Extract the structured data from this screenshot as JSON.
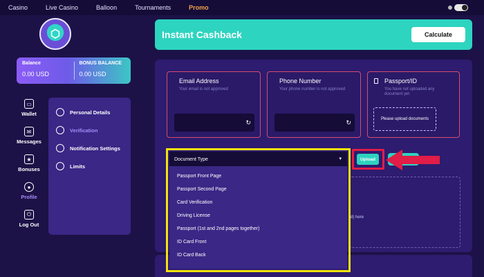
{
  "nav": {
    "items": [
      "Casino",
      "Live Casino",
      "Balloon",
      "Tournaments"
    ],
    "promo": "Promo"
  },
  "balance": {
    "label": "Balance",
    "value": "0.00 USD",
    "bonus_label": "BONUS BALANCE",
    "bonus_value": "0.00 USD"
  },
  "sidebar": {
    "items": [
      {
        "label": "Wallet",
        "icon": "wallet-icon"
      },
      {
        "label": "Messages",
        "icon": "messages-icon"
      },
      {
        "label": "Bonuses",
        "icon": "bonus-icon"
      },
      {
        "label": "Profile",
        "icon": "profile-icon",
        "active": true
      },
      {
        "label": "Log Out",
        "icon": "logout-icon"
      }
    ]
  },
  "profile_menu": {
    "items": [
      {
        "label": "Personal Details",
        "icon": "user-icon"
      },
      {
        "label": "Verification",
        "icon": "verification-icon",
        "active": true
      },
      {
        "label": "Notification Settings",
        "icon": "bell-icon"
      },
      {
        "label": "Limits",
        "icon": "limits-icon"
      }
    ]
  },
  "cashback": {
    "title": "Instant Cashback",
    "button": "Calculate"
  },
  "verification": {
    "email": {
      "title": "Email Address",
      "status": "Your email is not approved"
    },
    "phone": {
      "title": "Phone Number",
      "status": "Your phone number is not approved"
    },
    "passport": {
      "title": "Passport/ID",
      "status": "You have not uploaded any document yet",
      "upload_box": "Please upload documents"
    },
    "document_type": {
      "label": "Document Type",
      "options": [
        "Passport Front Page",
        "Passport Second Page",
        "Card Verification",
        "Driving License",
        "Passport (1st and 2nd pages together)",
        "ID Card Front",
        "ID Card Back"
      ]
    },
    "upload_button": "Upload",
    "upload_hint": "d) here"
  },
  "colors": {
    "teal": "#2dd4bf",
    "highlight_yellow": "#f4e30e",
    "highlight_red": "#e11d48",
    "panel": "#2d1c6f",
    "background": "#1c1247"
  }
}
